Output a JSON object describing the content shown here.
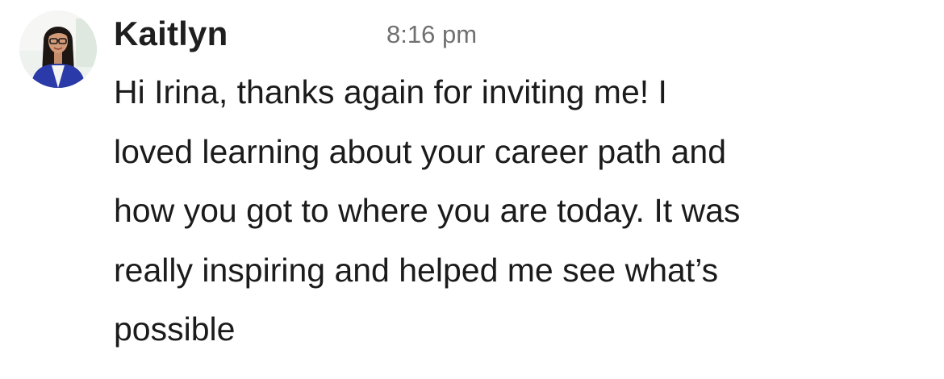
{
  "message": {
    "sender_name": "Kaitlyn",
    "timestamp": "8:16 pm",
    "body_lines": [
      "Hi Irina, thanks again for inviting me! I",
      "loved learning about your career path and",
      "how you got to where you are today. It was",
      "really inspiring and helped me see what’s",
      "possible"
    ]
  }
}
